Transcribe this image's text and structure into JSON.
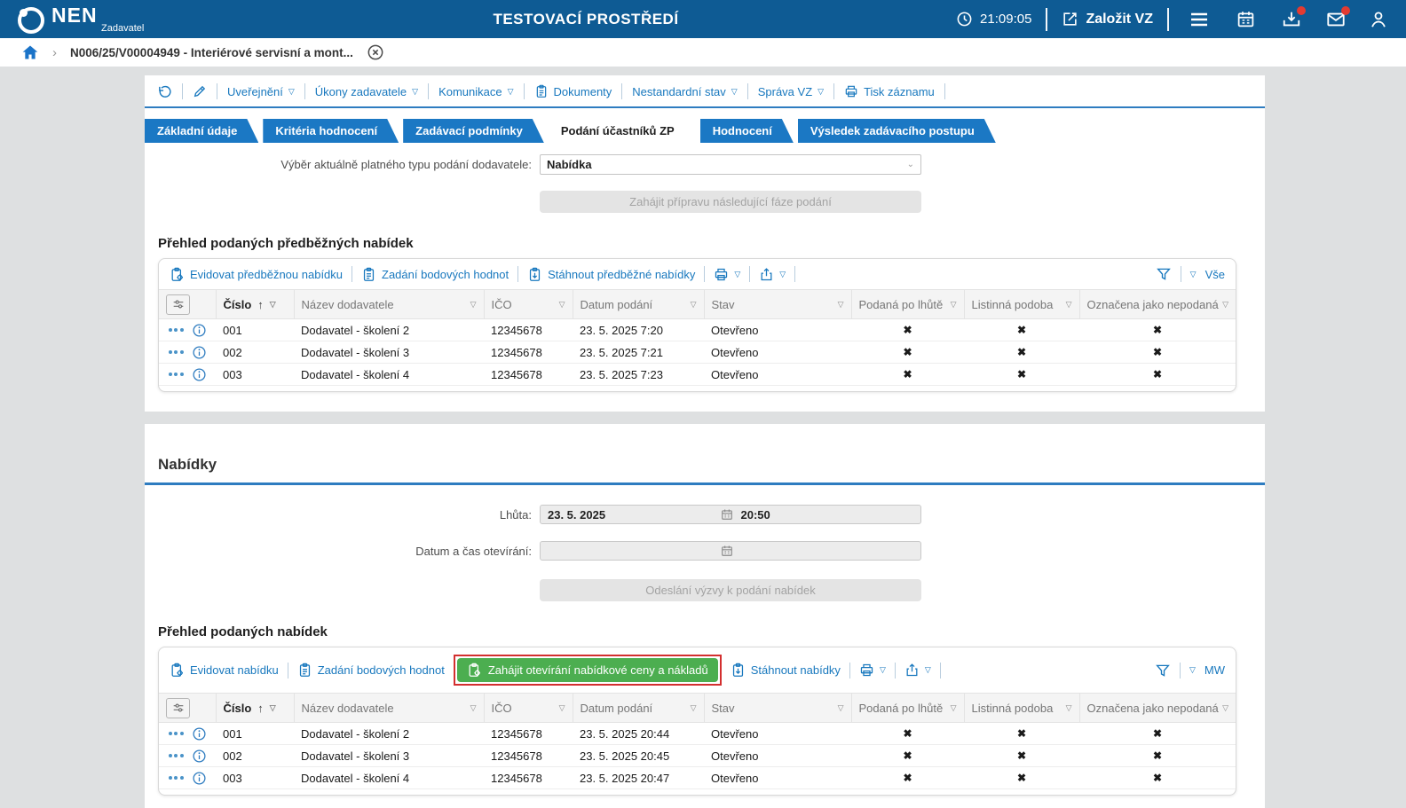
{
  "colors": {
    "brand_blue": "#0e5b94",
    "accent_blue": "#1878be",
    "tab_blue": "#1b78c4",
    "green": "#4cae50",
    "alert_red": "#d32f2f",
    "cross_red": "#c9302c"
  },
  "icons": {
    "caret": "▽",
    "sort_asc": "↑",
    "chevron_down": "⌄",
    "no_mark": "✖"
  },
  "header": {
    "brand": "NEN",
    "brand_sub": "Zadavatel",
    "env_title": "TESTOVACÍ PROSTŘEDÍ",
    "clock": "21:09:05",
    "create_vz": "Založit VZ"
  },
  "breadcrumb": {
    "record": "N006/25/V00004949 - Interiérové servisní a mont..."
  },
  "actionbar": {
    "uverejneni": "Uveřejnění",
    "ukony": "Úkony zadavatele",
    "komunikace": "Komunikace",
    "dokumenty": "Dokumenty",
    "nestandardni": "Nestandardní stav",
    "sprava": "Správa VZ",
    "tisk": "Tisk záznamu"
  },
  "tabs": {
    "t0": "Základní údaje",
    "t1": "Kritéria hodnocení",
    "t2": "Zadávací podmínky",
    "t3": "Podání účastníků ZP",
    "t4": "Hodnocení",
    "t5": "Výsledek zadávacího postupu"
  },
  "podani_form": {
    "label": "Výběr aktuálně platného typu podání dodavatele:",
    "selected": "Nabídka",
    "next_phase_button": "Zahájit přípravu následující fáze podání"
  },
  "columns": {
    "cislo": "Číslo",
    "nazev": "Název dodavatele",
    "ico": "IČO",
    "datum": "Datum podání",
    "stav": "Stav",
    "po_lhute": "Podaná po lhůtě",
    "listinna": "Listinná podoba",
    "nepodana": "Označena jako nepodaná"
  },
  "predbezne": {
    "title": "Přehled podaných předběžných nabídek",
    "actions": {
      "evidovat": "Evidovat předběžnou nabídku",
      "body": "Zadání bodových hodnot",
      "stahnout": "Stáhnout předběžné nabídky"
    },
    "scope": "Vše",
    "rows": [
      {
        "cislo": "001",
        "nazev": "Dodavatel - školení 2",
        "ico": "12345678",
        "datum": "23. 5. 2025 7:20",
        "stav": "Otevřeno"
      },
      {
        "cislo": "002",
        "nazev": "Dodavatel - školení 3",
        "ico": "12345678",
        "datum": "23. 5. 2025 7:21",
        "stav": "Otevřeno"
      },
      {
        "cislo": "003",
        "nazev": "Dodavatel - školení 4",
        "ico": "12345678",
        "datum": "23. 5. 2025 7:23",
        "stav": "Otevřeno"
      }
    ]
  },
  "nabidky": {
    "title": "Nabídky",
    "lhuta_label": "Lhůta:",
    "lhuta_date": "23. 5. 2025",
    "lhuta_time": "20:50",
    "oteviran_label": "Datum a čas otevírání:",
    "vyzva_button": "Odeslání výzvy k podání nabídek",
    "table_title": "Přehled podaných nabídek",
    "actions": {
      "evidovat": "Evidovat nabídku",
      "body": "Zadání bodových hodnot",
      "zahajit": "Zahájit otevírání nabídkové ceny a nákladů",
      "stahnout": "Stáhnout nabídky"
    },
    "scope": "MW",
    "rows": [
      {
        "cislo": "001",
        "nazev": "Dodavatel - školení 2",
        "ico": "12345678",
        "datum": "23. 5. 2025 20:44",
        "stav": "Otevřeno"
      },
      {
        "cislo": "002",
        "nazev": "Dodavatel - školení 3",
        "ico": "12345678",
        "datum": "23. 5. 2025 20:45",
        "stav": "Otevřeno"
      },
      {
        "cislo": "003",
        "nazev": "Dodavatel - školení 4",
        "ico": "12345678",
        "datum": "23. 5. 2025 20:47",
        "stav": "Otevřeno"
      }
    ]
  }
}
